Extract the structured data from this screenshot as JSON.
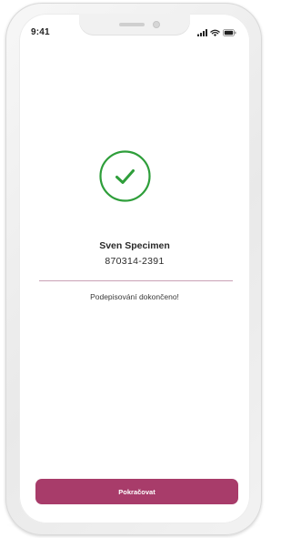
{
  "status_bar": {
    "time": "9:41",
    "icons": [
      "signal-icon",
      "wifi-icon",
      "battery-icon"
    ]
  },
  "success": {
    "icon": "checkmark-circle-icon",
    "accent_color": "#2e9e3a"
  },
  "user": {
    "name": "Sven Specimen",
    "id_number": "870314-2391"
  },
  "message": "Podepisování dokončeno!",
  "continue_button": {
    "label": "Pokračovat",
    "color": "#a83c6a"
  }
}
